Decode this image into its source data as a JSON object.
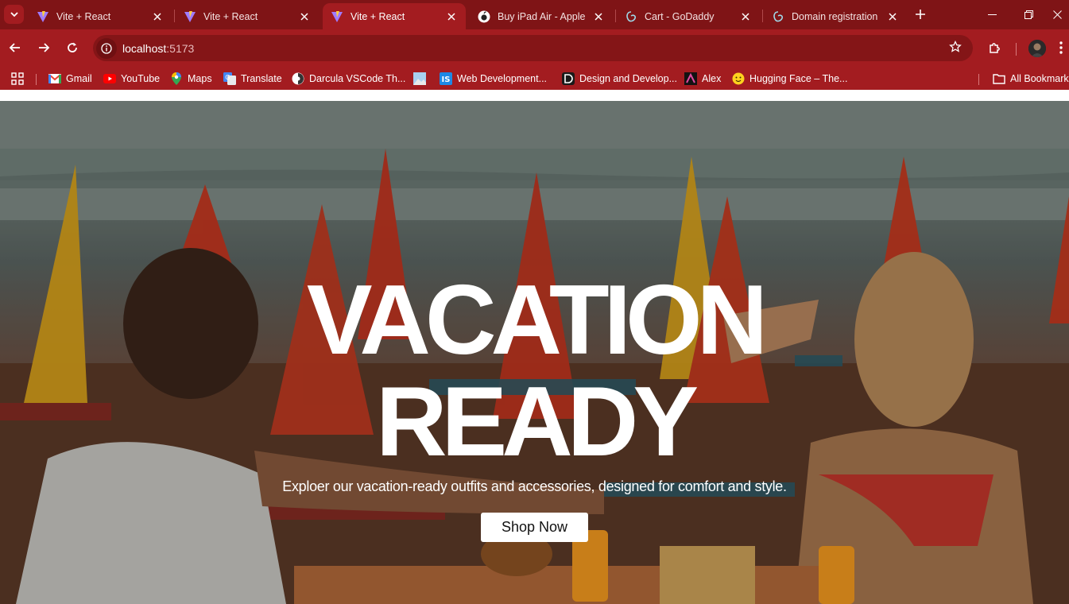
{
  "tabs": [
    {
      "title": "Vite + React",
      "icon": "vite-icon",
      "active": false
    },
    {
      "title": "Vite + React",
      "icon": "vite-icon",
      "active": false
    },
    {
      "title": "Vite + React",
      "icon": "vite-icon",
      "active": true
    },
    {
      "title": "Buy iPad Air - Apple (",
      "icon": "apple-icon",
      "active": false
    },
    {
      "title": "Cart - GoDaddy",
      "icon": "godaddy-icon",
      "active": false
    },
    {
      "title": "Domain registration |",
      "icon": "godaddy-icon",
      "active": false
    }
  ],
  "address_bar": {
    "host": "localhost",
    "port": ":5173"
  },
  "bookmarks": [
    {
      "label": "Gmail",
      "icon": "gmail-icon"
    },
    {
      "label": "YouTube",
      "icon": "youtube-icon"
    },
    {
      "label": "Maps",
      "icon": "maps-icon"
    },
    {
      "label": "Translate",
      "icon": "translate-icon"
    },
    {
      "label": "Darcula VSCode Th...",
      "icon": "darcula-icon"
    },
    {
      "label": "",
      "icon": "image-icon"
    },
    {
      "label": "Web Development...",
      "icon": "is-icon"
    },
    {
      "label": "Design and Develop...",
      "icon": "design-icon"
    },
    {
      "label": "Alex",
      "icon": "alex-icon"
    },
    {
      "label": "Hugging Face – The...",
      "icon": "hugging-face-icon"
    }
  ],
  "all_bookmarks_label": "All Bookmarks",
  "hero": {
    "title_line1": "VACATION",
    "title_line2": "READY",
    "subtitle": "Exploer our vacation-ready outfits and accessories, designed for comfort and style.",
    "cta_label": "Shop Now"
  },
  "colors": {
    "tabstrip": "#7f1416",
    "toolbar": "#a31c20",
    "omnibox": "#841517",
    "button_bg": "#ffffff",
    "title_text": "#ffffff"
  }
}
